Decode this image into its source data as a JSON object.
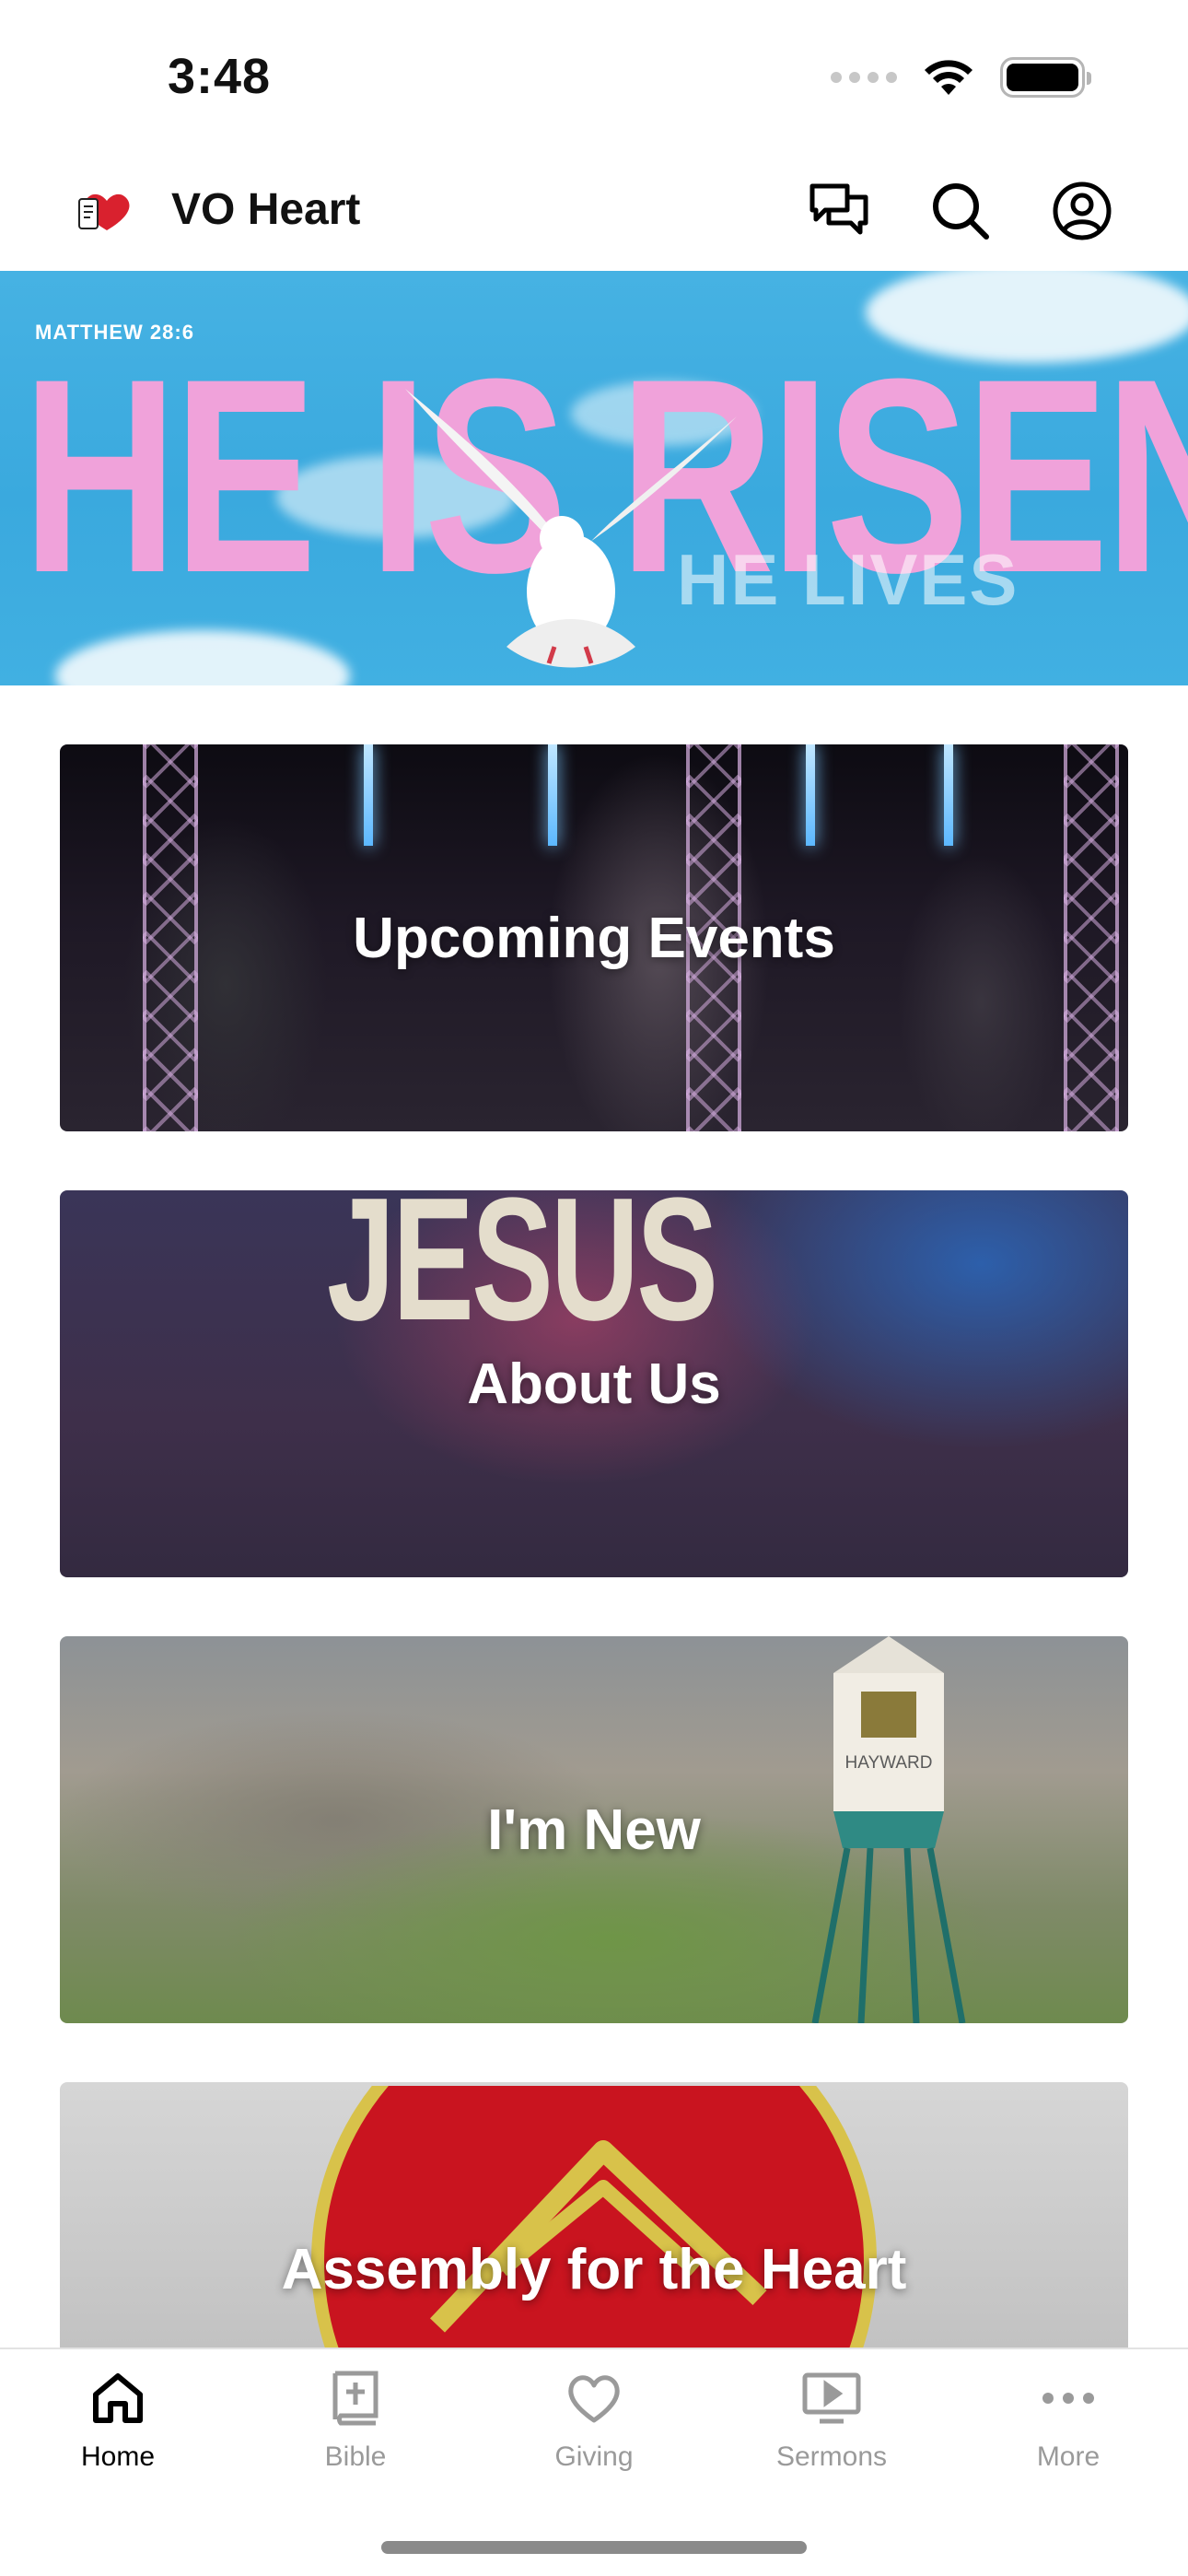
{
  "status_bar": {
    "time": "3:48"
  },
  "header": {
    "title": "VO Heart",
    "icons": [
      "chat-icon",
      "search-icon",
      "account-icon"
    ]
  },
  "hero": {
    "verse": "MATTHEW 28:6",
    "title": "HE IS RISEN",
    "subtitle": "HE LIVES",
    "colors": {
      "sky": "#3aa9de",
      "title": "#f0a2da"
    }
  },
  "tiles": [
    {
      "label": "Upcoming Events"
    },
    {
      "label": "About Us",
      "background_text": "JESUS"
    },
    {
      "label": "I'm New",
      "sign_text": "HAYWARD"
    },
    {
      "label": "Assembly for the Heart"
    }
  ],
  "tab_bar": {
    "items": [
      {
        "label": "Home",
        "icon": "home-icon",
        "active": true
      },
      {
        "label": "Bible",
        "icon": "bible-icon",
        "active": false
      },
      {
        "label": "Giving",
        "icon": "heart-icon",
        "active": false
      },
      {
        "label": "Sermons",
        "icon": "video-icon",
        "active": false
      },
      {
        "label": "More",
        "icon": "more-icon",
        "active": false
      }
    ]
  }
}
